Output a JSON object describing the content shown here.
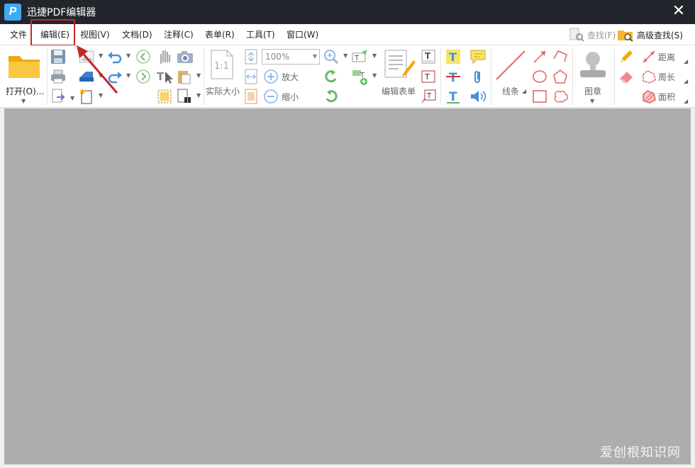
{
  "app": {
    "title": "迅捷PDF编辑器",
    "logo_letter": "P"
  },
  "menu": {
    "items": [
      {
        "label": "文件"
      },
      {
        "label": "编辑(E)"
      },
      {
        "label": "视图(V)"
      },
      {
        "label": "文档(D)"
      },
      {
        "label": "注释(C)"
      },
      {
        "label": "表单(R)"
      },
      {
        "label": "工具(T)"
      },
      {
        "label": "窗口(W)"
      }
    ],
    "find": "查找(F)",
    "advanced_find": "高级查找(S)"
  },
  "toolbar": {
    "open": "打开(O)...",
    "zoom_value": "100%",
    "actual_size": "实际大小",
    "zoom_in": "放大",
    "zoom_out": "缩小",
    "edit_form": "编辑表单",
    "line": "线条",
    "stamp": "图章",
    "distance": "距离",
    "perimeter": "周长",
    "area": "面积"
  },
  "watermark": "爱创根知识网",
  "colors": {
    "titlebar": "#22252b",
    "highlight": "#c0282d",
    "canvas": "#adadad",
    "accent_blue": "#3fa9f5"
  }
}
